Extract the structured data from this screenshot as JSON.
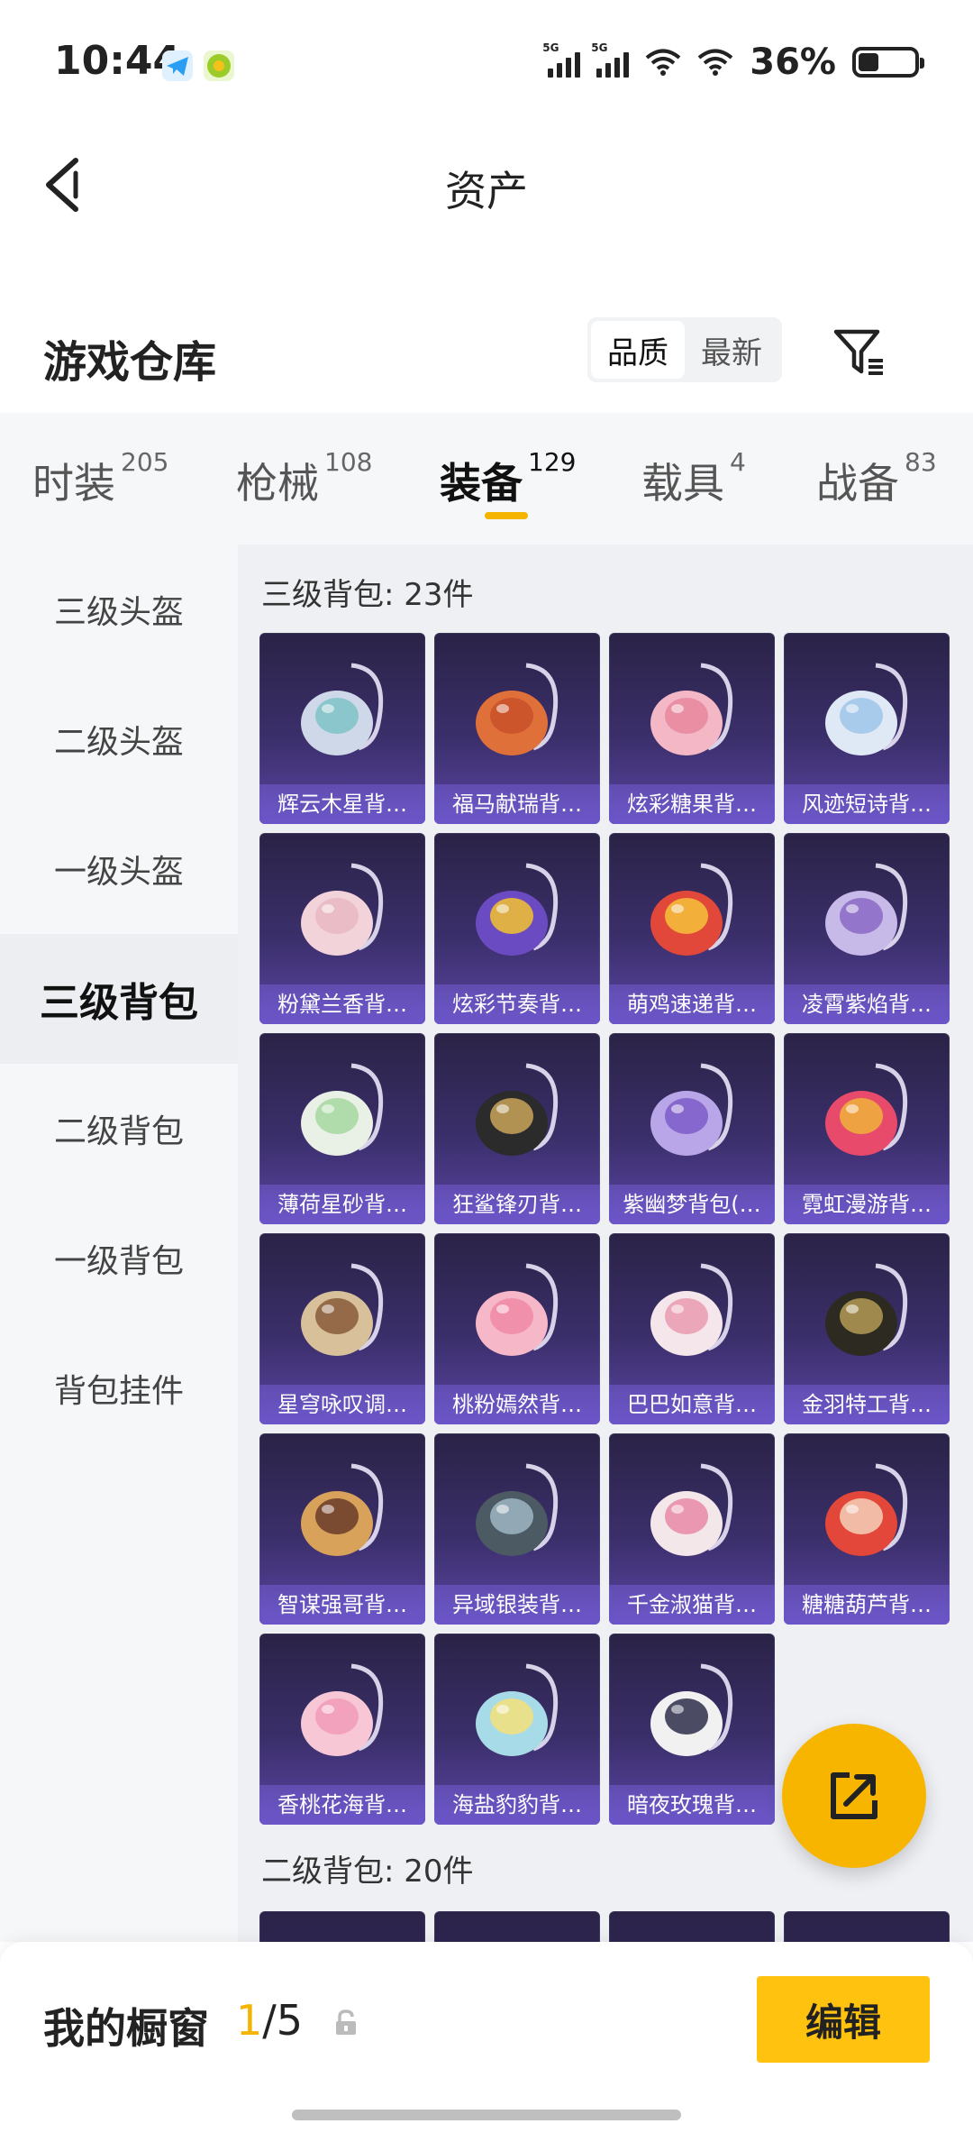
{
  "status_bar": {
    "time": "10:44",
    "battery": "36%",
    "network_tag": "5G"
  },
  "header": {
    "title": "资产"
  },
  "warehouse": {
    "label": "游戏仓库",
    "sort_options": [
      "品质",
      "最新"
    ]
  },
  "tabs": [
    {
      "label": "时装",
      "count": "205"
    },
    {
      "label": "枪械",
      "count": "108"
    },
    {
      "label": "装备",
      "count": "129"
    },
    {
      "label": "载具",
      "count": "4"
    },
    {
      "label": "战备",
      "count": "83"
    }
  ],
  "sidebar": [
    "三级头盔",
    "二级头盔",
    "一级头盔",
    "三级背包",
    "二级背包",
    "一级背包",
    "背包挂件"
  ],
  "sections": [
    {
      "title": "三级背包: 23件",
      "items": [
        "辉云木星背…",
        "福马献瑞背…",
        "炫彩糖果背…",
        "风迹短诗背…",
        "粉黛兰香背…",
        "炫彩节奏背…",
        "萌鸡速递背…",
        "凌霄紫焰背…",
        "薄荷星砂背…",
        "狂鲨锋刃背…",
        "紫幽梦背包(…",
        "霓虹漫游背…",
        "星穹咏叹调…",
        "桃粉嫣然背…",
        "巴巴如意背…",
        "金羽特工背…",
        "智谋强哥背…",
        "异域银装背…",
        "千金淑猫背…",
        "糖糖葫芦背…",
        "香桃花海背…",
        "海盐豹豹背…",
        "暗夜玫瑰背…"
      ]
    },
    {
      "title": "二级背包: 20件"
    }
  ],
  "bottom_bar": {
    "label": "我的橱窗",
    "current": "1",
    "total": "/5",
    "edit_label": "编辑"
  },
  "colors": {
    "accent": "#f5b400",
    "card_bg": "#3b2f6b"
  }
}
